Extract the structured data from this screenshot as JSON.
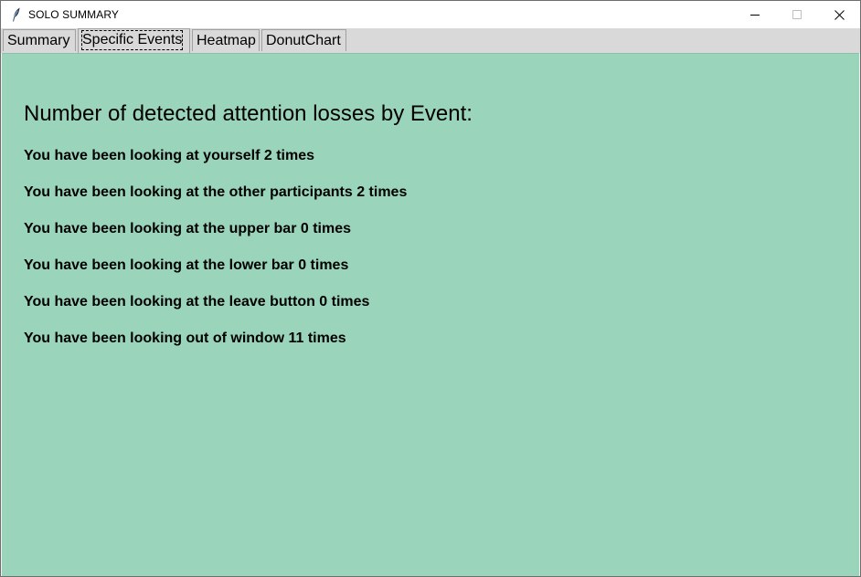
{
  "window": {
    "title": "SOLO SUMMARY",
    "app_icon": "feather-icon",
    "controls": [
      "minimize-icon",
      "maximize-icon",
      "close-icon"
    ]
  },
  "tabs": [
    {
      "label": "Summary",
      "active": false
    },
    {
      "label": "Specific Events",
      "active": true
    },
    {
      "label": "Heatmap",
      "active": false
    },
    {
      "label": "DonutChart",
      "active": false
    }
  ],
  "panel": {
    "background_color": "#99d4bb",
    "heading": "Number of detected attention losses by Event:",
    "events": [
      {
        "text": "You have been looking at yourself 2 times"
      },
      {
        "text": "You have been looking at the other participants 2 times"
      },
      {
        "text": "You have been looking at the upper bar 0 times"
      },
      {
        "text": "You have been looking at the lower bar 0 times"
      },
      {
        "text": "You have been looking at the leave button 0 times"
      },
      {
        "text": "You have been looking out of window 11 times"
      }
    ]
  }
}
